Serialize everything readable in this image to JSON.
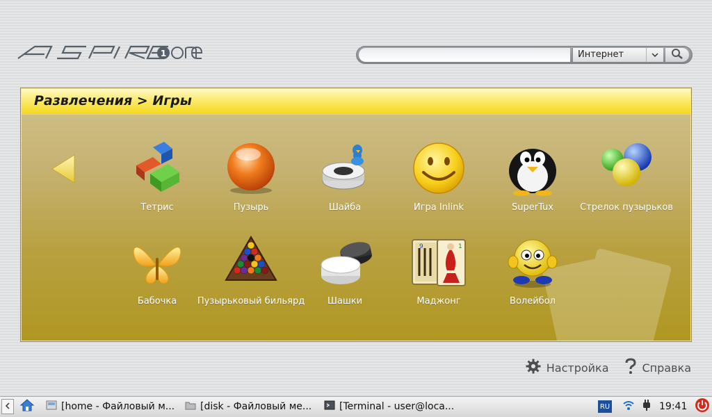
{
  "search": {
    "query": "",
    "engine": "Интернет"
  },
  "panel": {
    "breadcrumb": "Развлечения > Игры"
  },
  "apps": [
    {
      "label": "Тетрис"
    },
    {
      "label": "Пузырь"
    },
    {
      "label": "Шайба"
    },
    {
      "label": "Игра Inlink"
    },
    {
      "label": "SuperTux"
    },
    {
      "label": "Стрелок пузырьков"
    },
    {
      "label": "Бабочка"
    },
    {
      "label": "Пузырьковый бильярд"
    },
    {
      "label": "Шашки"
    },
    {
      "label": "Маджонг"
    },
    {
      "label": "Волейбол"
    }
  ],
  "footer": {
    "settings": "Настройка",
    "help": "Справка"
  },
  "taskbar": {
    "tasks": [
      {
        "label": "[home - Файловый м..."
      },
      {
        "label": "[disk - Файловый ме..."
      },
      {
        "label": "[Terminal - user@loca..."
      }
    ],
    "keyboard_layout": "RU",
    "clock": "19:41"
  },
  "colors": {
    "panel_gold": "#b8a040",
    "title_yellow": "#f5d81a",
    "nav_arrow": "#f3e27a",
    "power_red": "#d42a1e"
  }
}
